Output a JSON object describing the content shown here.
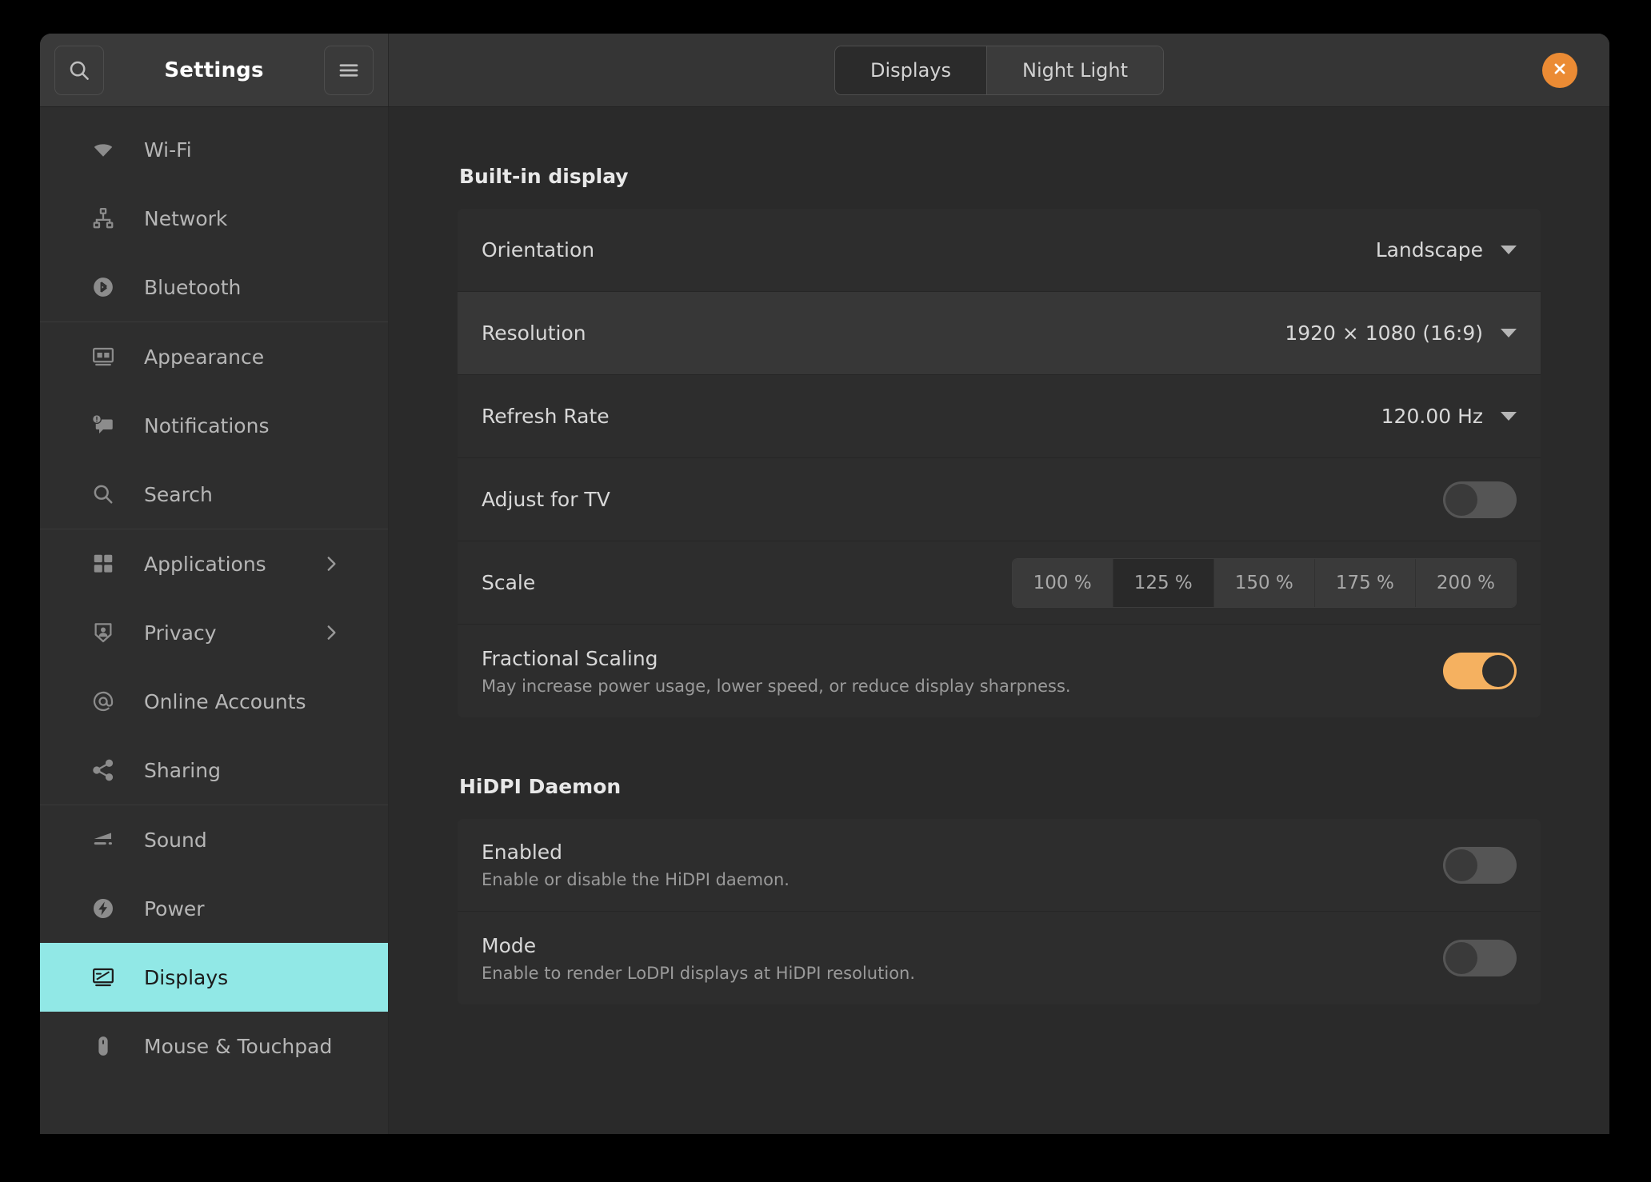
{
  "window": {
    "title": "Settings",
    "accent_orange": "#eb8b34",
    "selection_teal": "#91e8e6"
  },
  "header": {
    "search_icon": "search-icon",
    "menu_icon": "hamburger-menu-icon",
    "close_icon": "close-icon",
    "tabs": [
      {
        "label": "Displays",
        "active": true
      },
      {
        "label": "Night Light",
        "active": false
      }
    ]
  },
  "sidebar": {
    "groups": [
      {
        "items": [
          {
            "label": "Wi-Fi",
            "icon": "wifi-icon",
            "selected": false,
            "chevron": false
          },
          {
            "label": "Network",
            "icon": "network-icon",
            "selected": false,
            "chevron": false
          },
          {
            "label": "Bluetooth",
            "icon": "bluetooth-icon",
            "selected": false,
            "chevron": false
          }
        ]
      },
      {
        "items": [
          {
            "label": "Appearance",
            "icon": "appearance-icon",
            "selected": false,
            "chevron": false
          },
          {
            "label": "Notifications",
            "icon": "notifications-icon",
            "selected": false,
            "chevron": false
          },
          {
            "label": "Search",
            "icon": "search-icon",
            "selected": false,
            "chevron": false
          }
        ]
      },
      {
        "items": [
          {
            "label": "Applications",
            "icon": "applications-grid-icon",
            "selected": false,
            "chevron": true
          },
          {
            "label": "Privacy",
            "icon": "privacy-shield-icon",
            "selected": false,
            "chevron": true
          },
          {
            "label": "Online Accounts",
            "icon": "at-sign-icon",
            "selected": false,
            "chevron": false
          },
          {
            "label": "Sharing",
            "icon": "share-nodes-icon",
            "selected": false,
            "chevron": false
          }
        ]
      },
      {
        "items": [
          {
            "label": "Sound",
            "icon": "sound-volume-icon",
            "selected": false,
            "chevron": false
          },
          {
            "label": "Power",
            "icon": "power-bolt-icon",
            "selected": false,
            "chevron": false
          },
          {
            "label": "Displays",
            "icon": "display-monitor-icon",
            "selected": true,
            "chevron": false
          },
          {
            "label": "Mouse & Touchpad",
            "icon": "mouse-icon",
            "selected": false,
            "chevron": false
          }
        ]
      }
    ]
  },
  "main": {
    "builtin_display": {
      "title": "Built-in display",
      "orientation": {
        "label": "Orientation",
        "value": "Landscape"
      },
      "resolution": {
        "label": "Resolution",
        "value": "1920 × 1080 (16:9)"
      },
      "refresh_rate": {
        "label": "Refresh Rate",
        "value": "120.00 Hz"
      },
      "adjust_for_tv": {
        "label": "Adjust for TV",
        "enabled": false
      },
      "scale": {
        "label": "Scale",
        "options": [
          "100 %",
          "125 %",
          "150 %",
          "175 %",
          "200 %"
        ],
        "selected": "125 %"
      },
      "fractional_scaling": {
        "label": "Fractional Scaling",
        "description": "May increase power usage, lower speed, or reduce display sharpness.",
        "enabled": true
      }
    },
    "hidpi_daemon": {
      "title": "HiDPI Daemon",
      "enabled_row": {
        "label": "Enabled",
        "description": "Enable or disable the HiDPI daemon.",
        "enabled": false
      },
      "mode_row": {
        "label": "Mode",
        "description": "Enable to render LoDPI displays at HiDPI resolution.",
        "enabled": false
      }
    }
  }
}
